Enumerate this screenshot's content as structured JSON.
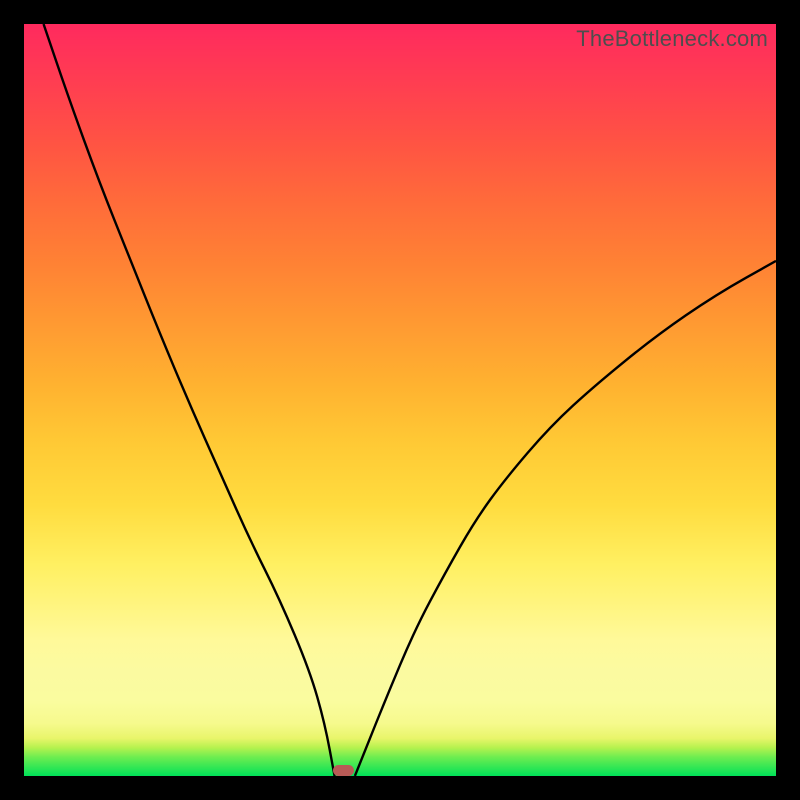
{
  "watermark": "TheBottleneck.com",
  "colors": {
    "frame": "#000000",
    "gradient_top": "#ff2a5e",
    "gradient_mid": "#fff062",
    "gradient_bottom": "#00e158",
    "curve": "#000000",
    "marker": "#b85a56"
  },
  "chart_data": {
    "type": "line",
    "title": "",
    "xlabel": "",
    "ylabel": "",
    "xlim": [
      0,
      100
    ],
    "ylim": [
      0,
      100
    ],
    "legend": false,
    "grid": false,
    "curve_description": "V-shaped bottleneck curve; y = 0 at the optimal x, rising steeply on the left branch and more gradually on the right branch",
    "series": [
      {
        "name": "bottleneck-left-branch",
        "x": [
          2.6,
          6,
          10,
          14,
          18,
          22,
          26,
          30,
          34,
          38,
          40,
          41.3
        ],
        "values": [
          100,
          90,
          79,
          69,
          59,
          49.5,
          40.5,
          31.5,
          23.5,
          14,
          7,
          0
        ]
      },
      {
        "name": "bottleneck-right-branch",
        "x": [
          44,
          48,
          52,
          56,
          60,
          64,
          70,
          76,
          84,
          92,
          100
        ],
        "values": [
          0,
          10,
          19.5,
          27,
          34,
          39.5,
          46.5,
          52,
          58.5,
          64,
          68.5
        ]
      }
    ],
    "optimal_marker": {
      "x": 42.5,
      "y": 0.7,
      "w": 2.9,
      "h": 1.5
    }
  }
}
